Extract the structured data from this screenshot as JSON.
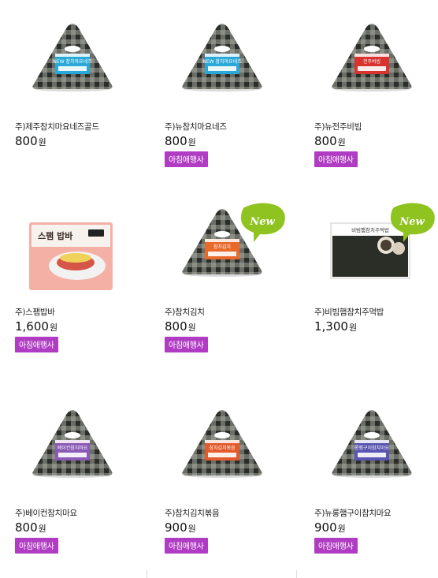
{
  "products": [
    {
      "name": "주)제주참치마요네즈골드",
      "price": "800",
      "unit": "원",
      "badge": "",
      "kind": "onigiri",
      "label_color": "#2aa9d8",
      "label_text": "NEW 참치마요네즈",
      "is_new": false
    },
    {
      "name": "주)뉴참치마요네즈",
      "price": "800",
      "unit": "원",
      "badge": "아침애행사",
      "kind": "onigiri",
      "label_color": "#2aa9d8",
      "label_text": "NEW 참치마요네즈",
      "is_new": false
    },
    {
      "name": "주)뉴전주비빔",
      "price": "800",
      "unit": "원",
      "badge": "아침애행사",
      "kind": "onigiri",
      "label_color": "#d8332f",
      "label_text": "전주비빔",
      "is_new": false
    },
    {
      "name": "주)스팸밥바",
      "price": "1,600",
      "unit": "원",
      "badge": "아침애행사",
      "kind": "spam",
      "label_color": "#f2a79e",
      "label_text": "스팸 밥바",
      "is_new": false
    },
    {
      "name": "주)참치김치",
      "price": "800",
      "unit": "원",
      "badge": "아침애행사",
      "kind": "onigiri",
      "label_color": "#e9692a",
      "label_text": "참치김치",
      "is_new": true
    },
    {
      "name": "주)비빔햄참치주먹밥",
      "price": "1,300",
      "unit": "원",
      "badge": "",
      "kind": "ball",
      "label_color": "#333333",
      "label_text": "비빔햄참치주먹밥",
      "is_new": true
    },
    {
      "name": "주)베이컨참치마요",
      "price": "800",
      "unit": "원",
      "badge": "아침애행사",
      "kind": "onigiri",
      "label_color": "#8a5bb5",
      "label_text": "베이컨참치마요",
      "is_new": false
    },
    {
      "name": "주)참치김치볶음",
      "price": "900",
      "unit": "원",
      "badge": "아침애행사",
      "kind": "onigiri",
      "label_color": "#e35a2c",
      "label_text": "참치김치볶음",
      "is_new": false
    },
    {
      "name": "주)뉴롱햄구이참치마요",
      "price": "900",
      "unit": "원",
      "badge": "아침애행사",
      "kind": "onigiri",
      "label_color": "#5a55b0",
      "label_text": "롱햄구이참치마요",
      "is_new": false
    }
  ],
  "new_label": "New"
}
